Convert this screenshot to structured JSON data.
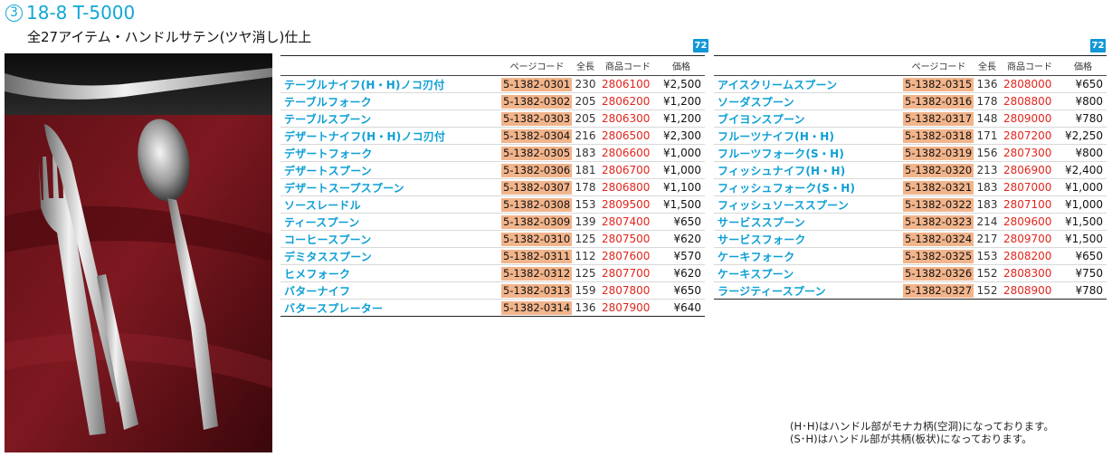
{
  "header": {
    "circled_number": "3",
    "title": "18-8 T-5000",
    "subtitle": "全27アイテム・ハンドルサテン(ツヤ消し)仕上"
  },
  "tag_label": "72",
  "columns": {
    "page_code": "ページコード",
    "length": "全長",
    "product_code": "商品コード",
    "price": "価格"
  },
  "left_table": [
    {
      "name": "テーブルナイフ(H・H)ノコ刃付",
      "page_code": "5-1382-0301",
      "length": "230",
      "code": "2806100",
      "price": "¥2,500"
    },
    {
      "name": "テーブルフォーク",
      "page_code": "5-1382-0302",
      "length": "205",
      "code": "2806200",
      "price": "¥1,200"
    },
    {
      "name": "テーブルスプーン",
      "page_code": "5-1382-0303",
      "length": "205",
      "code": "2806300",
      "price": "¥1,200"
    },
    {
      "name": "デザートナイフ(H・H)ノコ刃付",
      "page_code": "5-1382-0304",
      "length": "216",
      "code": "2806500",
      "price": "¥2,300"
    },
    {
      "name": "デザートフォーク",
      "page_code": "5-1382-0305",
      "length": "183",
      "code": "2806600",
      "price": "¥1,000"
    },
    {
      "name": "デザートスプーン",
      "page_code": "5-1382-0306",
      "length": "181",
      "code": "2806700",
      "price": "¥1,000"
    },
    {
      "name": "デザートスープスプーン",
      "page_code": "5-1382-0307",
      "length": "178",
      "code": "2806800",
      "price": "¥1,100"
    },
    {
      "name": "ソースレードル",
      "page_code": "5-1382-0308",
      "length": "153",
      "code": "2809500",
      "price": "¥1,500"
    },
    {
      "name": "ティースプーン",
      "page_code": "5-1382-0309",
      "length": "139",
      "code": "2807400",
      "price": "¥650"
    },
    {
      "name": "コーヒースプーン",
      "page_code": "5-1382-0310",
      "length": "125",
      "code": "2807500",
      "price": "¥620"
    },
    {
      "name": "デミタススプーン",
      "page_code": "5-1382-0311",
      "length": "112",
      "code": "2807600",
      "price": "¥570"
    },
    {
      "name": "ヒメフォーク",
      "page_code": "5-1382-0312",
      "length": "125",
      "code": "2807700",
      "price": "¥620"
    },
    {
      "name": "バターナイフ",
      "page_code": "5-1382-0313",
      "length": "159",
      "code": "2807800",
      "price": "¥650"
    },
    {
      "name": "バタースプレーター",
      "page_code": "5-1382-0314",
      "length": "136",
      "code": "2807900",
      "price": "¥640"
    }
  ],
  "right_table": [
    {
      "name": "アイスクリームスプーン",
      "page_code": "5-1382-0315",
      "length": "136",
      "code": "2808000",
      "price": "¥650"
    },
    {
      "name": "ソーダスプーン",
      "page_code": "5-1382-0316",
      "length": "178",
      "code": "2808800",
      "price": "¥800"
    },
    {
      "name": "ブイヨンスプーン",
      "page_code": "5-1382-0317",
      "length": "148",
      "code": "2809000",
      "price": "¥780"
    },
    {
      "name": "フルーツナイフ(H・H)",
      "page_code": "5-1382-0318",
      "length": "171",
      "code": "2807200",
      "price": "¥2,250"
    },
    {
      "name": "フルーツフォーク(S・H)",
      "page_code": "5-1382-0319",
      "length": "156",
      "code": "2807300",
      "price": "¥800"
    },
    {
      "name": "フィッシュナイフ(H・H)",
      "page_code": "5-1382-0320",
      "length": "213",
      "code": "2806900",
      "price": "¥2,400"
    },
    {
      "name": "フィッシュフォーク(S・H)",
      "page_code": "5-1382-0321",
      "length": "183",
      "code": "2807000",
      "price": "¥1,000"
    },
    {
      "name": "フィッシュソーススプーン",
      "page_code": "5-1382-0322",
      "length": "183",
      "code": "2807100",
      "price": "¥1,000"
    },
    {
      "name": "サービススプーン",
      "page_code": "5-1382-0323",
      "length": "214",
      "code": "2809600",
      "price": "¥1,500"
    },
    {
      "name": "サービスフォーク",
      "page_code": "5-1382-0324",
      "length": "217",
      "code": "2809700",
      "price": "¥1,500"
    },
    {
      "name": "ケーキフォーク",
      "page_code": "5-1382-0325",
      "length": "153",
      "code": "2808200",
      "price": "¥650"
    },
    {
      "name": "ケーキスプーン",
      "page_code": "5-1382-0326",
      "length": "152",
      "code": "2808300",
      "price": "¥750"
    },
    {
      "name": "ラージティースプーン",
      "page_code": "5-1382-0327",
      "length": "152",
      "code": "2808900",
      "price": "¥780"
    }
  ],
  "notes": [
    "(H･H)はハンドル部がモナカ柄(空洞)になっております。",
    "(S･H)はハンドル部が共柄(板状)になっております。"
  ],
  "colors": {
    "accent": "#11a7d7",
    "item_name": "#0d9fd5",
    "page_code_bg": "#f2b48b",
    "product_code": "#e1251b",
    "tag_bg": "#1297d6"
  },
  "photo": {
    "icon": "cutlery-photo",
    "subject": "knife, fork and spoon on dark red cloth"
  }
}
